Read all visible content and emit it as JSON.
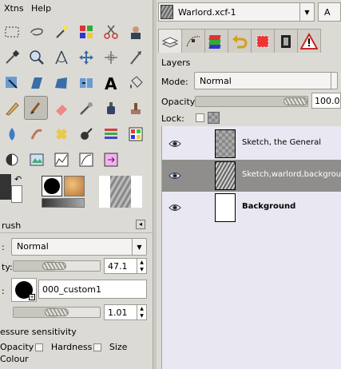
{
  "menubar": {
    "items": [
      {
        "label": "Xtns"
      },
      {
        "label": "Help"
      }
    ]
  },
  "tools": [
    "rect-select-icon",
    "lasso-icon",
    "fuzzy-select-icon",
    "color-select-icon",
    "scissors-icon",
    "foreground-select-icon",
    "color-picker-icon",
    "zoom-icon",
    "measure-icon",
    "move-icon",
    "align-icon",
    "crop-icon",
    "rotate-icon",
    "scale-icon",
    "shear-icon",
    "perspective-icon",
    "text-icon",
    "bucket-fill-icon",
    "pencil-icon",
    "paintbrush-icon",
    "eraser-icon",
    "airbrush-icon",
    "ink-icon",
    "clone-icon",
    "blur-icon",
    "smudge-icon",
    "heal-icon",
    "dodge-icon",
    "curves-icon",
    "levels-icon",
    "dodge-burn-icon",
    "pattern-icon",
    "histogram-icon",
    "gradient-icon",
    "gradient-2-icon"
  ],
  "tool_options": {
    "title": "rush",
    "mode_label": ":",
    "mode_value": "Normal",
    "opacity_label": "ty:",
    "opacity_value": "47.1",
    "opacity_fraction": 0.471,
    "brush_label": ":",
    "brush_value": "000_custom1",
    "scale_value": "1.01",
    "scale_fraction": 0.5,
    "pressure_title": "essure sensitivity",
    "pressure_opacity": "Opacity",
    "pressure_hardness": "Hardness",
    "pressure_size": "Size",
    "pressure_colour": "Colour"
  },
  "image_selector": {
    "title": "Warlord.xcf-1",
    "overflow_label": "A"
  },
  "dock_tabs": [
    "layers-tab-icon",
    "paths-tab-icon",
    "channels-tab-icon",
    "undo-tab-icon",
    "color-tab-icon",
    "sample-tab-icon",
    "warning-tab-icon"
  ],
  "layers": {
    "title": "Layers",
    "mode_label": "Mode:",
    "mode_value": "Normal",
    "opacity_label": "Opacity:",
    "opacity_value": "100.0",
    "opacity_fraction": 1.0,
    "lock_label": "Lock:",
    "items": [
      {
        "name": "Sketch, the General"
      },
      {
        "name": "Sketch,warlord,background"
      },
      {
        "name": "Background"
      }
    ]
  }
}
